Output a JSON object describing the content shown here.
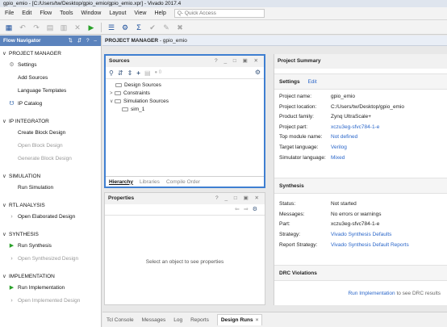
{
  "window": {
    "title": "gpio_emio - [C:/Users/tw/Desktop/gpio_emio/gpio_emio.xpr] - Vivado 2017.4"
  },
  "menu": {
    "items": [
      "File",
      "Edit",
      "Flow",
      "Tools",
      "Window",
      "Layout",
      "View",
      "Help"
    ],
    "quick_access_placeholder": "Q- Quick Access"
  },
  "flow_navigator": {
    "title": "Flow Navigator",
    "sections": [
      {
        "label": "PROJECT MANAGER",
        "items": [
          {
            "label": "Settings",
            "icon": "gear-icon",
            "enabled": true
          },
          {
            "label": "Add Sources",
            "enabled": true
          },
          {
            "label": "Language Templates",
            "enabled": true
          },
          {
            "label": "IP Catalog",
            "icon": "ip-icon",
            "enabled": true
          }
        ]
      },
      {
        "label": "IP INTEGRATOR",
        "items": [
          {
            "label": "Create Block Design",
            "enabled": true
          },
          {
            "label": "Open Block Design",
            "enabled": false
          },
          {
            "label": "Generate Block Design",
            "enabled": false
          }
        ]
      },
      {
        "label": "SIMULATION",
        "items": [
          {
            "label": "Run Simulation",
            "enabled": true
          }
        ]
      },
      {
        "label": "RTL ANALYSIS",
        "items": [
          {
            "label": "Open Elaborated Design",
            "icon": "chevron-right-icon",
            "enabled": true
          }
        ]
      },
      {
        "label": "SYNTHESIS",
        "items": [
          {
            "label": "Run Synthesis",
            "icon": "play-icon",
            "enabled": true
          },
          {
            "label": "Open Synthesized Design",
            "icon": "chevron-right-icon",
            "enabled": false
          }
        ]
      },
      {
        "label": "IMPLEMENTATION",
        "items": [
          {
            "label": "Run Implementation",
            "icon": "play-icon",
            "enabled": true
          },
          {
            "label": "Open Implemented Design",
            "icon": "chevron-right-icon",
            "enabled": false
          }
        ]
      }
    ]
  },
  "project_manager_bar": {
    "label": "PROJECT MANAGER",
    "project": "- gpio_emio"
  },
  "sources": {
    "title": "Sources",
    "count": "0",
    "tree": [
      {
        "label": "Design Sources",
        "level": 0,
        "expandable": false
      },
      {
        "label": "Constraints",
        "level": 0,
        "expandable": true
      },
      {
        "label": "Simulation Sources",
        "level": 0,
        "expandable": true,
        "expanded": true
      },
      {
        "label": "sim_1",
        "level": 1,
        "expandable": false
      }
    ],
    "tabs": [
      "Hierarchy",
      "Libraries",
      "Compile Order"
    ],
    "active_tab": "Hierarchy"
  },
  "properties": {
    "title": "Properties",
    "empty_message": "Select an object to see properties"
  },
  "project_summary": {
    "title": "Project Summary",
    "settings_label": "Settings",
    "edit_label": "Edit",
    "settings": [
      {
        "key": "Project name:",
        "value": "gpio_emio",
        "link": false
      },
      {
        "key": "Project location:",
        "value": "C:/Users/tw/Desktop/gpio_emio",
        "link": false
      },
      {
        "key": "Product family:",
        "value": "Zynq UltraScale+",
        "link": false
      },
      {
        "key": "Project part:",
        "value": "xczu3eg-sfvc784-1-e",
        "link": true
      },
      {
        "key": "Top module name:",
        "value": "Not defined",
        "link": true
      },
      {
        "key": "Target language:",
        "value": "Verilog",
        "link": true
      },
      {
        "key": "Simulator language:",
        "value": "Mixed",
        "link": true
      }
    ],
    "synthesis_label": "Synthesis",
    "synthesis": [
      {
        "key": "Status:",
        "value": "Not started",
        "link": false
      },
      {
        "key": "Messages:",
        "value": "No errors or warnings",
        "link": false
      },
      {
        "key": "Part:",
        "value": "xczu3eg-sfvc784-1-e",
        "link": false
      },
      {
        "key": "Strategy:",
        "value": "Vivado Synthesis Defaults",
        "link": true
      },
      {
        "key": "Report Strategy:",
        "value": "Vivado Synthesis Default Reports",
        "link": true
      }
    ],
    "drc_label": "DRC Violations",
    "drc_link": "Run Implementation",
    "drc_text": "to see DRC results"
  },
  "bottom_tabs": {
    "items": [
      "Tcl Console",
      "Messages",
      "Log",
      "Reports",
      "Design Runs"
    ],
    "active": "Design Runs"
  },
  "colors": {
    "accent": "#5b83bd",
    "link": "#2a66c9",
    "run_green": "#2aa12a",
    "focus_border": "#3f7fd1"
  }
}
